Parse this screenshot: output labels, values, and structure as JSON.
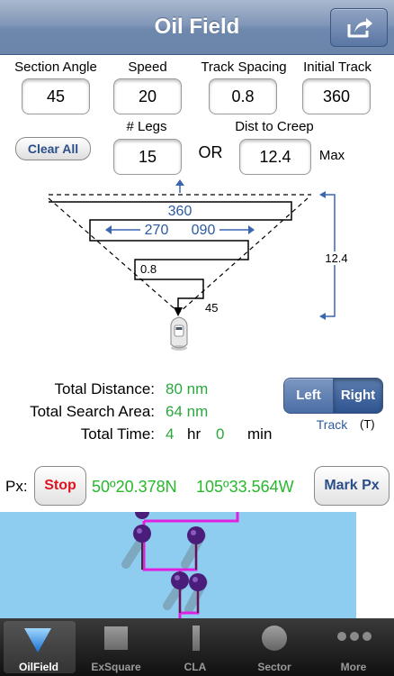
{
  "header": {
    "title": "Oil Field",
    "share_icon": "share-icon"
  },
  "inputs": {
    "section_angle": {
      "label": "Section Angle",
      "value": "45"
    },
    "speed": {
      "label": "Speed",
      "value": "20"
    },
    "track_spacing": {
      "label": "Track Spacing",
      "value": "0.8"
    },
    "initial_track": {
      "label": "Initial Track",
      "value": "360"
    },
    "legs": {
      "label": "# Legs",
      "value": "15"
    },
    "dist_to_creep": {
      "label": "Dist to Creep",
      "value": "12.4"
    },
    "or_label": "OR",
    "max_label": "Max"
  },
  "clear_all_label": "Clear All",
  "diagram": {
    "track_label": "360",
    "left_label": "270",
    "right_label": "090",
    "spacing_label": "0.8",
    "angle_label": "45",
    "creep_label": "12.4",
    "vessel_icon": "boat-icon"
  },
  "stats": {
    "total_distance": {
      "label": "Total Distance:",
      "value": "80 nm"
    },
    "total_search_area": {
      "label": "Total Search Area:",
      "value": "64 nm"
    },
    "total_time": {
      "label": "Total Time:",
      "hours": "4",
      "hr_unit": "hr",
      "minutes": "0",
      "min_unit": "min"
    }
  },
  "direction": {
    "left_label": "Left",
    "right_label": "Right",
    "selected": "Right",
    "track_label": "Track",
    "track_suffix": "(T)"
  },
  "position": {
    "label": "Px:",
    "stop_label": "Stop",
    "lat": "50º20.378N",
    "lon": "105º33.564W",
    "mark_label": "Mark Px"
  },
  "colors": {
    "green": "#27b82c",
    "blue_text": "#2c5aa0",
    "stop_red": "#e0141e",
    "path_magenta": "#e020e0",
    "marker_purple": "#4a1d7a",
    "map_water": "#8fcdf0"
  },
  "tabs": [
    {
      "label": "OilField",
      "icon": "triangle-icon",
      "active": true
    },
    {
      "label": "ExSquare",
      "icon": "square-icon",
      "active": false
    },
    {
      "label": "CLA",
      "icon": "bar-icon",
      "active": false
    },
    {
      "label": "Sector",
      "icon": "circle-icon",
      "active": false
    },
    {
      "label": "More",
      "icon": "more-dots-icon",
      "active": false
    }
  ]
}
